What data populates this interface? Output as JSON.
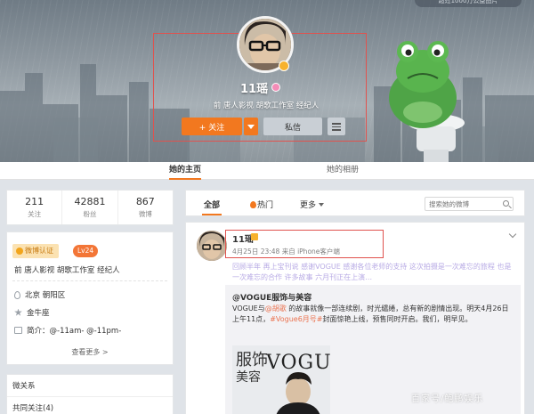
{
  "cover": {
    "top_badge": "超过1000万公益图片",
    "name": "11瑶",
    "bio": "前 唐人影视 胡歌工作室 经纪人",
    "follow_label": "+ 关注",
    "message_label": "私信"
  },
  "tabs": [
    {
      "label": "她的主页"
    },
    {
      "label": "她的相册"
    }
  ],
  "stats": [
    {
      "value": "211",
      "label": "关注"
    },
    {
      "value": "42881",
      "label": "粉丝"
    },
    {
      "value": "867",
      "label": "微博"
    }
  ],
  "info": {
    "auth_tag": "微博认证",
    "level": "Lv24",
    "description": "前 唐人影视 胡歌工作室 经纪人",
    "location": "北京 朝阳区",
    "constellation": "金牛座",
    "intro": "简介：@-11am- @-11pm-",
    "see_more": "查看更多 >"
  },
  "relations": {
    "title": "微关系",
    "common": "共同关注(4)"
  },
  "filter": {
    "all": "全部",
    "hot": "热门",
    "more": "更多",
    "search_placeholder": "搜索她的微博"
  },
  "post": {
    "author": "11瑶",
    "time": "4月25日 23:48 来自 iPhone客户端",
    "text": "回顾半年 再上宝刊说 感谢VOGUE 感谢各位老师的支持  这次拍摄是一次难忘的旅程 也是一次难忘的合作 许多故事 六月刊正在上演…",
    "repost": {
      "author": "@VOGUE服饰与美容",
      "body_pre": "VOGUE与",
      "body_link1": "@胡歌",
      "body_mid": " 的故事就像一部连续剧，时光缱绻，总有新的剧情出现。明天4月26日上午11点，",
      "body_link2": "#Vogue6月号#",
      "body_post": "封面惊艳上线，预售同时开启。我们，明早见。"
    }
  },
  "watermark": "百家号/鲍鹏娱乐",
  "colors": {
    "accent_orange": "#f2781f",
    "highlight_box": "#e0524e",
    "link": "#eb7350"
  }
}
